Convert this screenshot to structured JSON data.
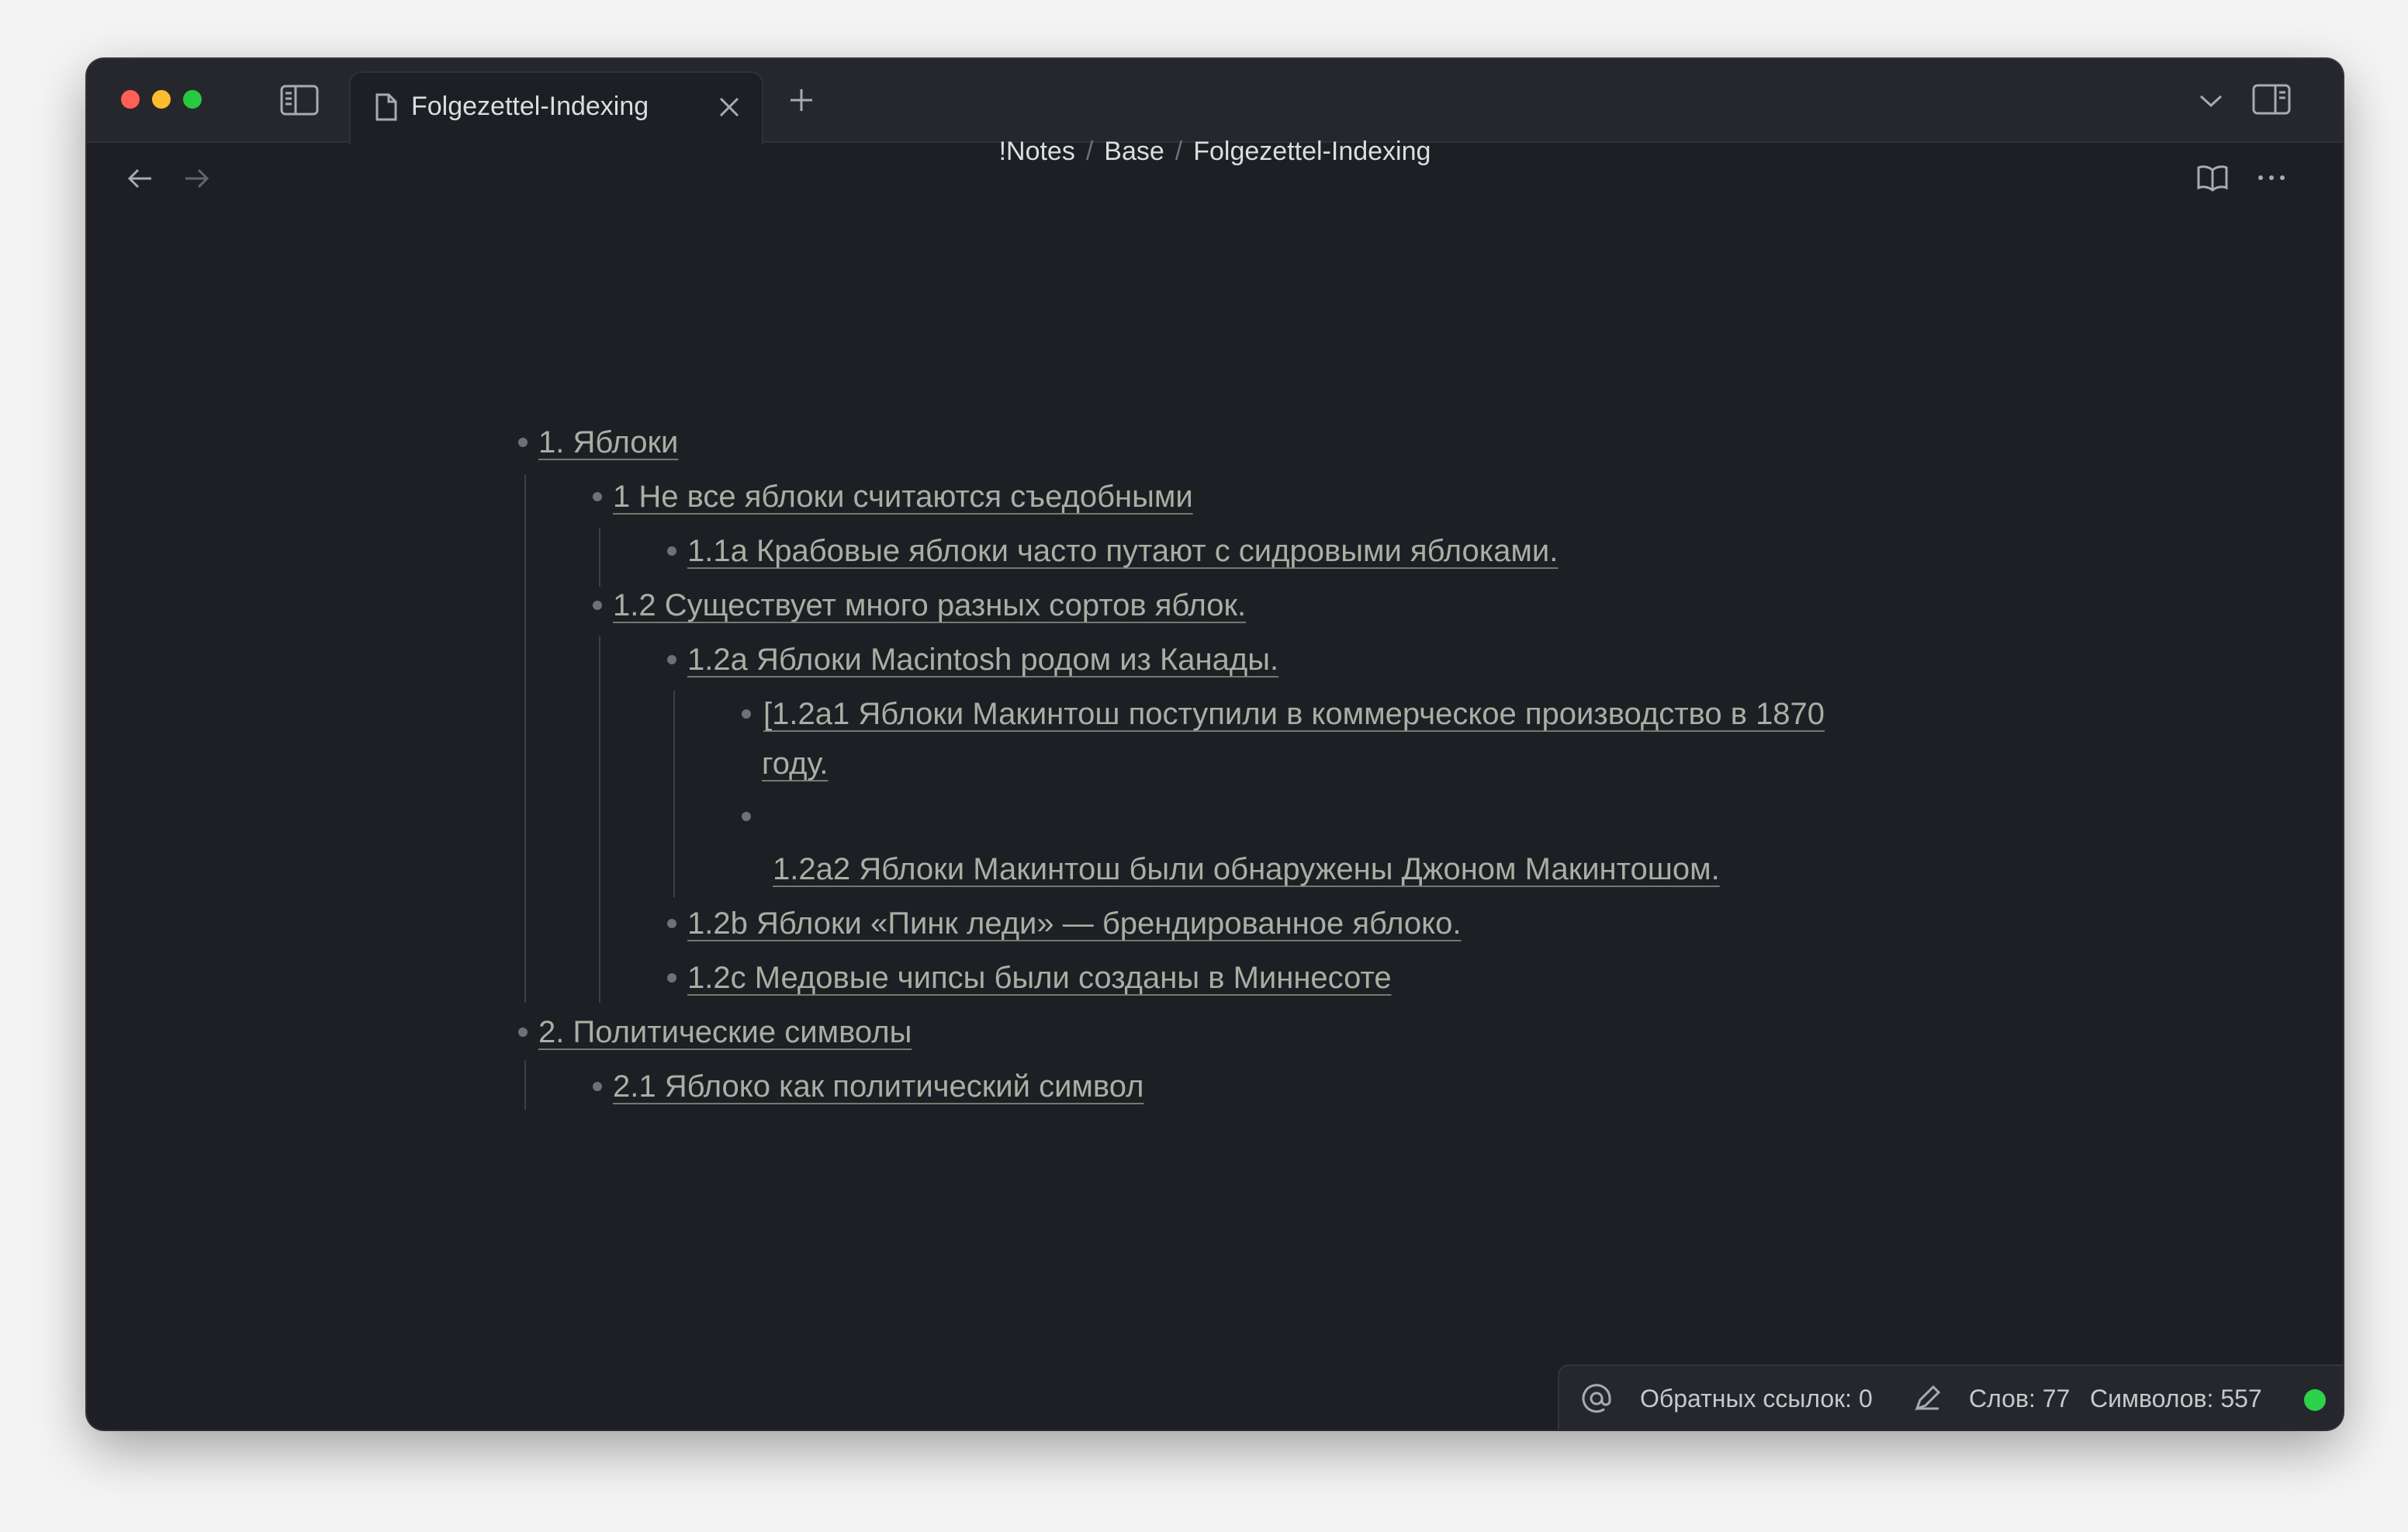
{
  "tab": {
    "title": "Folgezettel-Indexing"
  },
  "breadcrumb": {
    "parts": [
      "!Notes",
      "Base",
      "Folgezettel-Indexing"
    ],
    "separator": "/"
  },
  "outline": [
    {
      "level": 0,
      "text": "1. Яблоки"
    },
    {
      "level": 1,
      "text": "1 Не все яблоки считаются съедобными"
    },
    {
      "level": 2,
      "text": "1.1a Крабовые яблоки часто путают с сидровыми яблоками."
    },
    {
      "level": 1,
      "text": "1.2 Существует много разных сортов яблок."
    },
    {
      "level": 2,
      "text": "1.2a Яблоки Macintosh родом из Канады."
    },
    {
      "level": 3,
      "text_line1": "[1.2a1 Яблоки Макинтош поступили в коммерческое производство в 1870",
      "text_line2": "году."
    },
    {
      "level": 3,
      "text": ""
    },
    {
      "level": 3,
      "text_pre": "1.2a2 Яблоки Макинтош были обнаружены Джоном ",
      "text_misspelled": "Макинтошом",
      "text_post": "."
    },
    {
      "level": 2,
      "text": "1.2b Яблоки «Пинк леди» — брендированное яблоко."
    },
    {
      "level": 2,
      "text": "1.2c Медовые чипсы были созданы в Миннесоте"
    },
    {
      "level": 0,
      "text": "2. Политические символы"
    },
    {
      "level": 1,
      "text": "2.1 Яблоко как политический символ"
    }
  ],
  "statusbar": {
    "backlinks": "Обратных ссылок: 0",
    "words": "Слов: 77",
    "chars": "Символов: 557",
    "sync_color": "#2bd24a"
  },
  "colors": {
    "background": "#1e1f24",
    "link_text": "#a6b0a3",
    "accent_green": "#2bd24a"
  },
  "icons": [
    "sidebar-toggle-icon",
    "document-icon",
    "close-icon",
    "plus-icon",
    "chevron-down-icon",
    "right-sidebar-icon",
    "arrow-left-icon",
    "arrow-right-icon",
    "book-open-icon",
    "more-horizontal-icon",
    "at-sign-icon",
    "pencil-icon"
  ]
}
